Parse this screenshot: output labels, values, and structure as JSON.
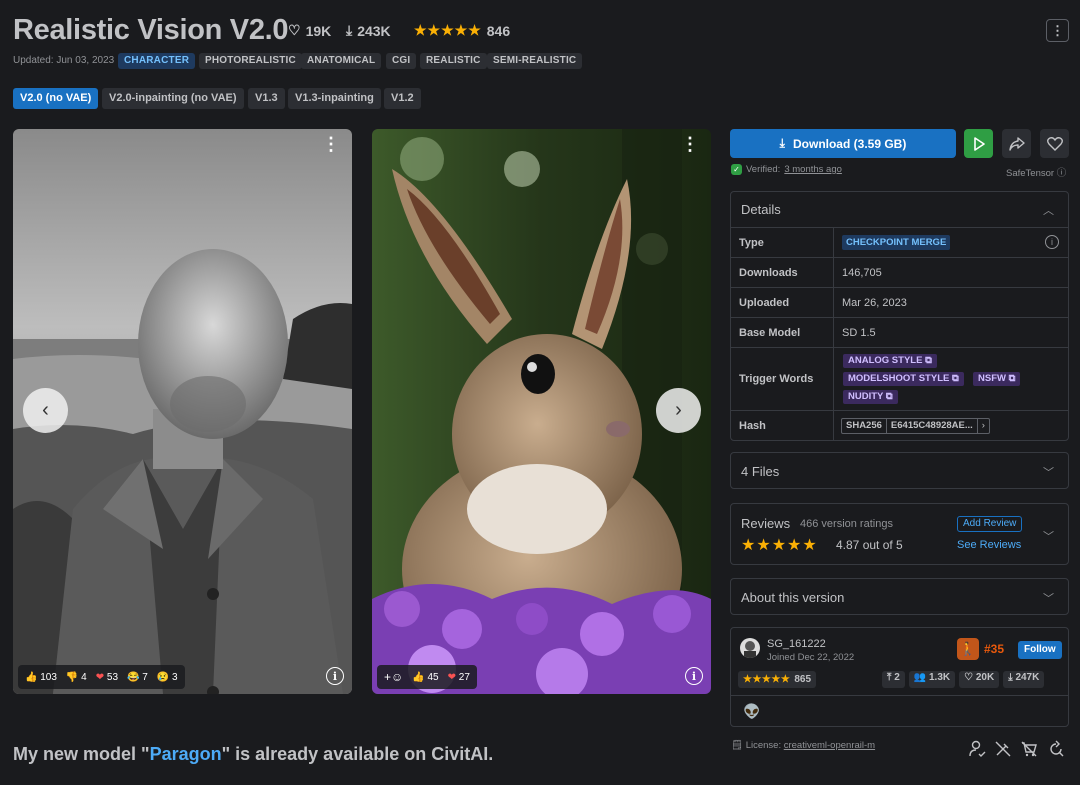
{
  "header": {
    "title": "Realistic Vision V2.0",
    "likes": "19K",
    "downloads": "243K",
    "rating_count": "846",
    "updated": "Updated: Jun 03, 2023",
    "tags": [
      "CHARACTER",
      "PHOTOREALISTIC",
      "ANATOMICAL",
      "CGI",
      "REALISTIC",
      "SEMI-REALISTIC"
    ]
  },
  "versions": [
    "V2.0 (no VAE)",
    "V2.0-inpainting (no VAE)",
    "V1.3",
    "V1.3-inpainting",
    "V1.2"
  ],
  "gallery": {
    "card1": {
      "reactions": [
        "103",
        "4",
        "53",
        "7",
        "3"
      ]
    },
    "card2": {
      "reactions": [
        "45",
        "27"
      ]
    }
  },
  "sidebar": {
    "download_label": "Download (3.59 GB)",
    "verified_label": "Verified:",
    "verified_time": "3 months ago",
    "safetensor": "SafeTensor",
    "details": {
      "title": "Details",
      "type_label": "Type",
      "type_value": "CHECKPOINT MERGE",
      "downloads_label": "Downloads",
      "downloads_value": "146,705",
      "uploaded_label": "Uploaded",
      "uploaded_value": "Mar 26, 2023",
      "base_model_label": "Base Model",
      "base_model_value": "SD 1.5",
      "trigger_label": "Trigger Words",
      "trigger_words": [
        "ANALOG STYLE",
        "MODELSHOOT STYLE",
        "NSFW",
        "NUDITY"
      ],
      "hash_label": "Hash",
      "hash_type": "SHA256",
      "hash_value": "E6415C48928AE..."
    },
    "files": "4 Files",
    "reviews": {
      "title": "Reviews",
      "count": "466 version ratings",
      "score": "4.87 out of 5",
      "add_review": "Add Review",
      "see_reviews": "See Reviews"
    },
    "about": "About this version",
    "creator": {
      "name": "SG_161222",
      "joined": "Joined Dec 22, 2022",
      "rank": "#35",
      "follow": "Follow",
      "ratings": "865",
      "uploads": "2",
      "followers": "1.3K",
      "likes": "20K",
      "downloads": "247K"
    },
    "license_label": "License:",
    "license_link": "creativeml-openrail-m"
  },
  "footer": {
    "text_before": "My new model \"",
    "link": "Paragon",
    "text_after": "\" is already available on CivitAI."
  },
  "colors": {
    "accent": "#1971c2",
    "background": "#1a1b1e",
    "panel_border": "#373a40",
    "star": "#fab005",
    "play": "#2f9e44"
  }
}
